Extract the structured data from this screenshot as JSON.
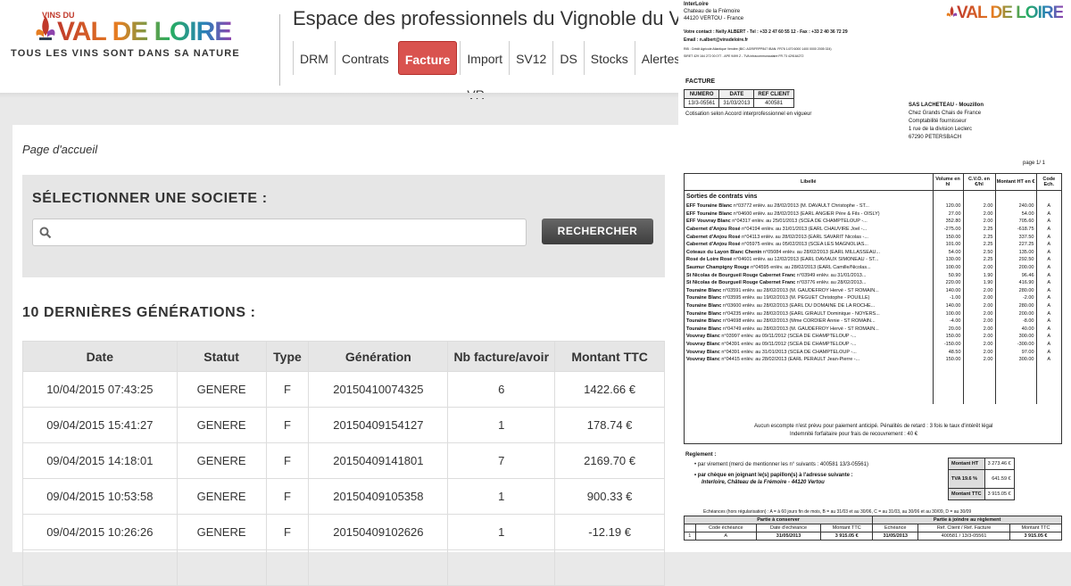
{
  "logo": {
    "small": "VINS DU",
    "main": "VAL DE LOIRE",
    "tagline": "TOUS LES VINS SONT DANS SA NATURE"
  },
  "site_title": "Espace des professionnels du Vignoble du Val de Loire",
  "nav": [
    "DRM",
    "Contrats",
    "Facture",
    "Import VR",
    "SV12",
    "DS",
    "Stocks",
    "Alertes"
  ],
  "nav_active": "Facture",
  "breadcrumb": "Page d'accueil",
  "search": {
    "heading": "SÉLECTIONNER UNE SOCIETE :",
    "placeholder": "",
    "button": "RECHERCHER"
  },
  "generations": {
    "title": "10 DERNIÈRES GÉNÉRATIONS :",
    "columns": [
      "Date",
      "Statut",
      "Type",
      "Génération",
      "Nb facture/avoir",
      "Montant TTC"
    ],
    "rows": [
      [
        "10/04/2015 07:43:25",
        "GENERE",
        "F",
        "20150410074325",
        "6",
        "1422.66 €"
      ],
      [
        "09/04/2015 15:41:27",
        "GENERE",
        "F",
        "20150409154127",
        "1",
        "178.74 €"
      ],
      [
        "09/04/2015 14:18:01",
        "GENERE",
        "F",
        "20150409141801",
        "7",
        "2169.70 €"
      ],
      [
        "09/04/2015 10:53:58",
        "GENERE",
        "F",
        "20150409105358",
        "1",
        "900.33 €"
      ],
      [
        "09/04/2015 10:26:26",
        "GENERE",
        "F",
        "20150409102626",
        "1",
        "-12.19 €"
      ],
      [
        "",
        "",
        "",
        "",
        "",
        ""
      ]
    ]
  },
  "invoice": {
    "sender": [
      "InterLoire",
      "Chateau de la Frémoire",
      "44120 VERTOU - France"
    ],
    "contact": "Votre contact : Nelly ALBERT - Tel : +33 2 47 60 55 12 - Fax : +33 2 40 36 72 29",
    "email": "Email : n.albert@vinsdeloire.fr",
    "legal1": "RIB : Crédit Agricole Atlantique Vendée (BIC: AGRIFRPP847 IBAN: FR76 1470 6000 1400 0000 2005 024)",
    "legal2": "SIRET 429 164 272 00 077 - APE 9499 Z - TVA intracommunautaire FR 73 429164272",
    "doc_title": "FACTURE",
    "ref_headers": [
      "NUMERO",
      "DATE",
      "REF CLIENT"
    ],
    "ref_values": [
      "13/3-05561",
      "31/03/2013",
      "400581"
    ],
    "cotisation": "Cotisation selon Accord interprofessionnel en vigueur",
    "client": [
      "SAS LACHETEAU - Mouzillon",
      "Chez Grands Chais de France",
      "Comptabilité fournisseur",
      "1 rue de la division Leclerc",
      "67290 PETERSBACH"
    ],
    "page": "page 1/ 1",
    "line_headers": [
      "Libellé",
      "Volume en hl",
      "C.V.O. en €/hl",
      "Montant HT en €",
      "Code Ech."
    ],
    "section": "Sorties de contrats vins",
    "lines": [
      [
        "EFF Touraine Blanc n°03772 enlèv. au 28/02/2013 (M. DAVAULT Christophe - ST...",
        "120.00",
        "2.00",
        "240.00",
        "A"
      ],
      [
        "EFF Touraine Blanc n°04600 enlèv. au 28/02/2013 (EARL ANGIER Père & Fils - OISLY)",
        "27.00",
        "2.00",
        "54.00",
        "A"
      ],
      [
        "EFF Vouvray Blanc n°04317 enlèv. au 25/01/2013 (SCEA DE CHAMPTELOUP -...",
        "352.80",
        "2.00",
        "705.60",
        "A"
      ],
      [
        "Cabernet d'Anjou Rosé n°04194 enlèv. au 31/01/2013 (EARL CHAUVIRE Joel -...",
        "-275.00",
        "2.25",
        "-618.75",
        "A"
      ],
      [
        "Cabernet d'Anjou Rosé n°04113 enlèv. au 28/02/2013 (EARL SAVARIT Nicolas -...",
        "150.00",
        "2.25",
        "337.50",
        "A"
      ],
      [
        "Cabernet d'Anjou Rosé n°05975 enlèv. au 05/02/2013 (SCEA LES MAGNOLIAS...",
        "101.00",
        "2.25",
        "227.25",
        "A"
      ],
      [
        "Coteaux du Layon Blanc Chenin n°05084 enlèv. au 28/02/2013 (EARL MILLASSEAU...",
        "54.00",
        "2.50",
        "135.00",
        "A"
      ],
      [
        "Rosé de Loire Rosé n°04601 enlèv. au 12/02/2013 (EARL DAVIAUX SIMONEAU - ST...",
        "130.00",
        "2.25",
        "292.50",
        "A"
      ],
      [
        "Saumur Champigny Rouge n°04595 enlèv. au 28/02/2013 (EARL Camille/Nicolas...",
        "100.00",
        "2.00",
        "200.00",
        "A"
      ],
      [
        "St Nicolas de Bourgueil Rouge Cabernet Franc n°03949 enlèv. au 31/01/2013...",
        "50.90",
        "1.90",
        "96.46",
        "A"
      ],
      [
        "St Nicolas de Bourgueil Rouge Cabernet Franc n°03776 enlèv. au 28/02/2013...",
        "220.00",
        "1.90",
        "416.90",
        "A"
      ],
      [
        "Touraine Blanc n°03591 enlèv. au 28/02/2013 (M. GAUDEFROY Hervé - ST ROMAIN...",
        "140.00",
        "2.00",
        "280.00",
        "A"
      ],
      [
        "Touraine Blanc n°03595 enlèv. au 19/02/2013 (M. PEGUET Christophe - POUILLE)",
        "-1.00",
        "2.00",
        "-2.00",
        "A"
      ],
      [
        "Touraine Blanc n°03600 enlèv. au 28/02/2013 (EARL DU DOMAINE DE LA ROCHE...",
        "140.00",
        "2.00",
        "280.00",
        "A"
      ],
      [
        "Touraine Blanc n°04235 enlèv. au 28/02/2013 (EARL GIRAULT Dominique - NOYERS...",
        "100.00",
        "2.00",
        "200.00",
        "A"
      ],
      [
        "Touraine Blanc n°04698 enlèv. au 28/02/2013 (Mme CORDIER Annie - ST ROMAIN...",
        "-4.00",
        "2.00",
        "-8.00",
        "A"
      ],
      [
        "Touraine Blanc n°04749 enlèv. au 28/02/2013 (M. GAUDEFROY Hervé - ST ROMAIN...",
        "20.00",
        "2.00",
        "40.00",
        "A"
      ],
      [
        "Vouvray Blanc n°03997 enlèv. au 09/11/2012 (SCEA DE CHAMPTELOUP -...",
        "150.00",
        "2.00",
        "300.00",
        "A"
      ],
      [
        "Vouvray Blanc n°04391 enlèv. au 09/11/2012 (SCEA DE CHAMPTELOUP -...",
        "-150.00",
        "2.00",
        "-300.00",
        "A"
      ],
      [
        "Vouvray Blanc n°04391 enlèv. au 31/01/2013 (SCEA DE CHAMPTELOUP -...",
        "48.50",
        "2.00",
        "97.00",
        "A"
      ],
      [
        "Vouvray Blanc n°04415 enlèv. au 28/02/2013 (EARL PERAULT Jean-Pierre -...",
        "150.00",
        "2.00",
        "300.00",
        "A"
      ]
    ],
    "footnote1": "Aucun escompte n'est prévu pour paiement anticipé. Pénalités de retard : 3 fois le taux d'intérêt légal",
    "footnote2": "Indemnité forfaitaire pour frais de recouvrement : 40 €",
    "reglement": "Reglement :",
    "virement": "par virement (merci de mentionner les n° suivants : 400581 13/3-05561)",
    "cheque": "par chèque en joignant le(s) papillon(s) à l'adresse suivante :",
    "cheque_addr": "Interloire, Château de la Frémoire - 44120 Vertou",
    "totals": [
      [
        "Montant HT",
        "3 273.46 €"
      ],
      [
        "TVA 19.6 %",
        "641.59 €"
      ],
      [
        "Montant TTC",
        "3 915.05 €"
      ]
    ],
    "echeances": "Echéances (hors régularisation) : A = à 60 jours fin de mois, B = au 31/03 et au 30/06, C = au 31/03, au 30/06 et au 30/09, D = au 30/09",
    "sched_left_title": "Partie à conserver",
    "sched_right_title": "Partie à joindre au règlement",
    "sched_headers": [
      "Code échéance",
      "Date d'échéance",
      "Montant TTC",
      "Echéance",
      "Ref. Client / Ref. Facture",
      "Montant TTC"
    ],
    "sched_row": [
      "1",
      "A",
      "31/05/2013",
      "3 915.05 €",
      "31/05/2013",
      "400581 / 13/3-05561",
      "3 915.05 €"
    ]
  },
  "colors": {
    "accent": "#d9534f",
    "button": "#4a4a4a"
  }
}
